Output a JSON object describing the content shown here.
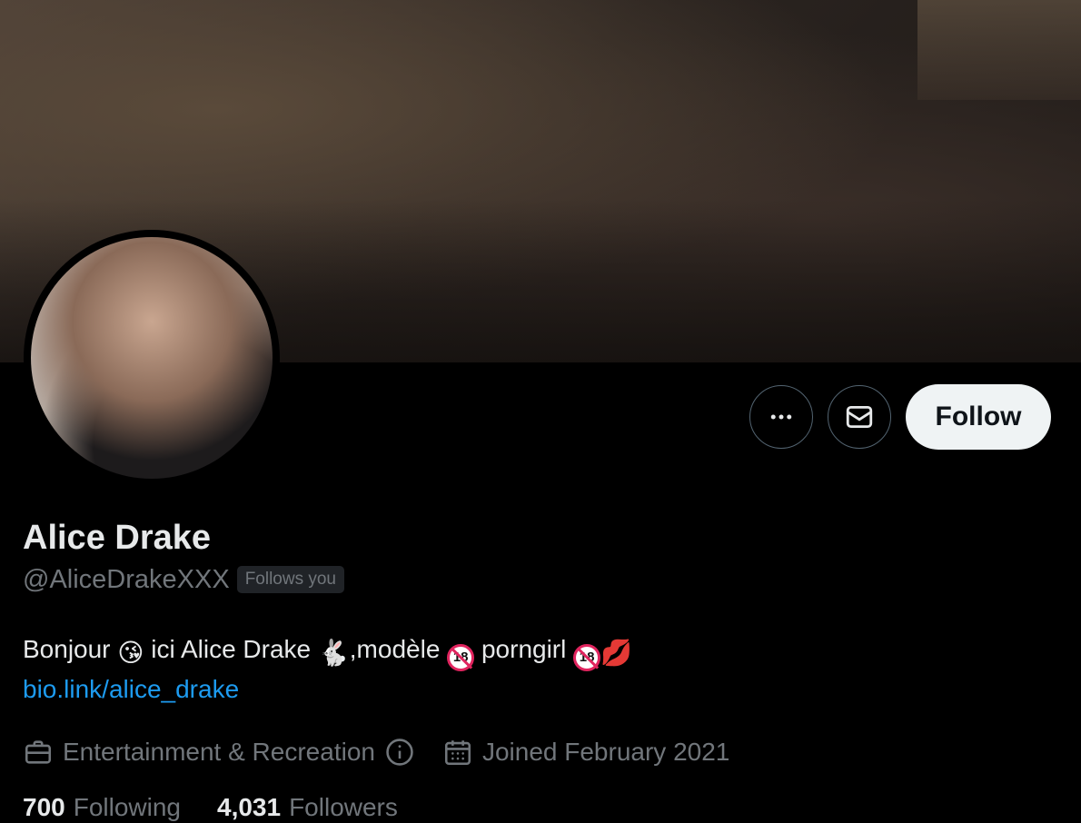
{
  "profile": {
    "name": "Alice Drake",
    "handle": "@AliceDrakeXXX",
    "follows_you_label": "Follows you",
    "bio": {
      "part1": "Bonjour",
      "part2": "ici Alice Drake",
      "part3": ",modèle",
      "part4": "porngirl",
      "emoji_wink_kiss": "😘",
      "emoji_rabbit": "🐇",
      "emoji_kiss_mark": "💋",
      "badge_18": "18"
    },
    "link": "bio.link/alice_drake",
    "category": "Entertainment & Recreation",
    "joined": "Joined February 2021",
    "following_count": "700",
    "following_label": "Following",
    "followers_count": "4,031",
    "followers_label": "Followers"
  },
  "actions": {
    "follow_label": "Follow",
    "more_icon": "more-horizontal-icon",
    "message_icon": "envelope-icon"
  },
  "colors": {
    "background": "#000000",
    "text_primary": "#e7e9ea",
    "text_secondary": "#71767b",
    "link": "#1d9bf0",
    "follow_bg": "#eff3f4",
    "border": "#536471"
  }
}
